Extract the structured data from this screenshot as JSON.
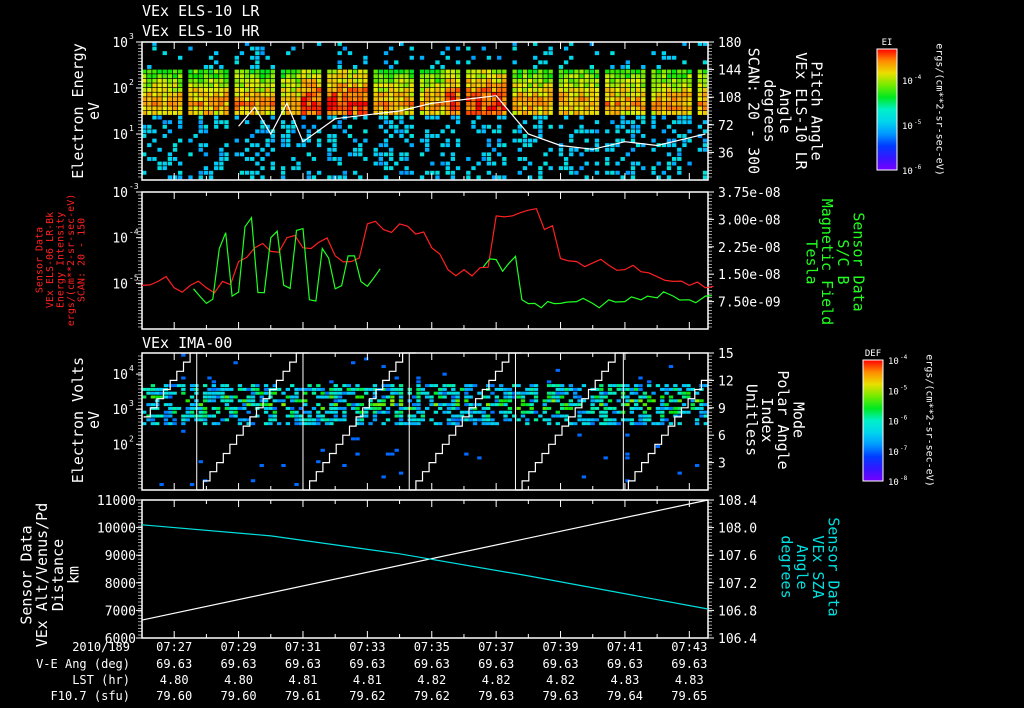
{
  "colors": {
    "white": "#ffffff",
    "red": "#ff2020",
    "green": "#20ff20",
    "cyan": "#00e0e0"
  },
  "time_axis": {
    "start_label": "2010/189",
    "t0_minutes_after_0726": 0,
    "t_end_minutes_after_0726": 17.58,
    "ticks": [
      "07:27",
      "07:29",
      "07:31",
      "07:33",
      "07:35",
      "07:37",
      "07:39",
      "07:41",
      "07:43"
    ],
    "tick_minutes": [
      1,
      3,
      5,
      7,
      9,
      11,
      13,
      15,
      17
    ]
  },
  "ephemeris": [
    {
      "label": "V-E Ang (deg)",
      "values": [
        "69.63",
        "69.63",
        "69.63",
        "69.63",
        "69.63",
        "69.63",
        "69.63",
        "69.63",
        "69.63"
      ]
    },
    {
      "label": "LST (hr)",
      "values": [
        "4.80",
        "4.80",
        "4.81",
        "4.81",
        "4.82",
        "4.82",
        "4.82",
        "4.83",
        "4.83"
      ]
    },
    {
      "label": "F10.7 (sfu)",
      "values": [
        "79.60",
        "79.60",
        "79.61",
        "79.62",
        "79.62",
        "79.63",
        "79.63",
        "79.64",
        "79.65"
      ]
    }
  ],
  "chart_data": [
    {
      "type": "heatmap",
      "title": [
        "VEx ELS-10 LR",
        "VEx ELS-10 HR"
      ],
      "ylabel": [
        "Electron Energy",
        "eV"
      ],
      "yscale": "log",
      "ylim": [
        1,
        1000
      ],
      "yticks": [
        "10",
        "10",
        "10"
      ],
      "yticks_exp": [
        "3",
        "2",
        "1"
      ],
      "y2label": [
        "Pitch Angle",
        "VEx ELS-10 LR",
        "Angle",
        "degrees",
        "SCAN: 20 - 300"
      ],
      "y2lim": [
        0,
        180
      ],
      "y2ticks": [
        "180",
        "144",
        "108",
        "72",
        "36"
      ],
      "colorbar": {
        "title": "EI",
        "ticks": [
          "10",
          "10",
          "10"
        ],
        "ticks_exp": [
          "-4",
          "-5",
          "-6"
        ],
        "units": "ergs/(cm**2-sr-sec-eV)"
      },
      "band_eV": [
        20,
        200
      ],
      "peak_eV": 40,
      "pitch_angle_overlay": {
        "t": [
          0,
          2,
          3,
          3.5,
          4,
          4.5,
          5,
          6,
          7,
          8,
          9,
          10,
          11,
          12,
          13,
          14,
          15,
          16,
          17,
          17.5
        ],
        "deg": [
          null,
          null,
          70,
          95,
          60,
          100,
          50,
          80,
          85,
          90,
          100,
          105,
          110,
          60,
          45,
          40,
          50,
          45,
          55,
          60
        ]
      }
    },
    {
      "type": "line",
      "ylabel": [
        "Sensor Data",
        "VEx ELS-06 LR-Bk",
        "Energy Intensity",
        "ergs/(cm**2-sr-sec-eV)",
        "SCAN: 20 - 150"
      ],
      "yscale": "log",
      "ylim": [
        1e-06,
        0.001
      ],
      "yticks": [
        "10",
        "10",
        "10"
      ],
      "yticks_exp": [
        "-3",
        "-4",
        "-5"
      ],
      "y2label": [
        "Sensor Data",
        "S/C B",
        "Magnetic Field",
        "Tesla"
      ],
      "y2lim": [
        0,
        3.75e-08
      ],
      "y2ticks": [
        "3.75e-08",
        "3.00e-08",
        "2.25e-08",
        "1.50e-08",
        "7.50e-09"
      ],
      "series": [
        {
          "name": "ELS-06 energy intensity",
          "color": "red",
          "axis": "left",
          "t": [
            0,
            0.5,
            1,
            1.5,
            2,
            2.5,
            3,
            3.5,
            4,
            4.5,
            5,
            5.5,
            6,
            6.5,
            7,
            7.5,
            8,
            8.5,
            9,
            9.5,
            10,
            10.5,
            11,
            11.5,
            12,
            12.5,
            13,
            13.5,
            14,
            14.5,
            15,
            15.5,
            16,
            16.5,
            17,
            17.5
          ],
          "values": [
            9e-06,
            1.1e-05,
            8e-06,
            9e-06,
            8e-06,
            1.1e-05,
            3e-05,
            6e-05,
            5e-05,
            0.0001,
            6e-05,
            8e-05,
            4e-05,
            3e-05,
            0.0002,
            0.00015,
            0.0002,
            0.00012,
            6e-05,
            2e-05,
            2e-05,
            2.2e-05,
            0.0003,
            0.0003,
            0.0004,
            0.00015,
            3.5e-05,
            3e-05,
            2.8e-05,
            2.5e-05,
            2e-05,
            1.8e-05,
            1.4e-05,
            1.1e-05,
            9e-06,
            8e-06
          ]
        },
        {
          "name": "S/C B magnetic field",
          "color": "green",
          "axis": "right",
          "t": [
            1.6,
            2,
            2.4,
            2.8,
            3.2,
            3.6,
            4,
            4.4,
            4.8,
            5.2,
            5.6,
            6,
            6.4,
            6.8,
            7.2,
            10.6,
            11,
            11.4,
            11.8,
            12.2,
            12.6,
            13,
            13.5,
            14,
            14.5,
            15,
            15.5,
            16,
            16.5,
            17,
            17.5
          ],
          "values": [
            1.1e-08,
            7e-09,
            2.2e-08,
            9e-09,
            2.8e-08,
            1e-08,
            2.5e-08,
            1.2e-08,
            2.7e-08,
            8e-09,
            2.2e-08,
            1.1e-08,
            2e-08,
            1.3e-08,
            1.4e-08,
            1.7e-08,
            1.9e-08,
            1.8e-08,
            8e-09,
            7e-09,
            7.5e-09,
            7e-09,
            7.5e-09,
            7e-09,
            8e-09,
            7.5e-09,
            8e-09,
            8.5e-09,
            9e-09,
            8e-09,
            9e-09
          ]
        }
      ]
    },
    {
      "type": "heatmap",
      "title": "VEx IMA-00",
      "ylabel": [
        "Electron Volts",
        "eV"
      ],
      "yscale": "log",
      "ylim": [
        5,
        40000
      ],
      "yticks": [
        "10",
        "10",
        "10"
      ],
      "yticks_exp": [
        "4",
        "3",
        "2"
      ],
      "y2label": [
        "Mode",
        "Polar Angle",
        "Index",
        "Unitless"
      ],
      "y2lim": [
        0,
        15
      ],
      "y2ticks": [
        "15",
        "12",
        "9",
        "6",
        "3"
      ],
      "colorbar": {
        "title": "DEF",
        "ticks": [
          "10",
          "10",
          "10",
          "10",
          "10"
        ],
        "ticks_exp": [
          "-4",
          "-5",
          "-6",
          "-7",
          "-8"
        ],
        "units": "ergs/(cm**2-sr-sec-eV)"
      },
      "scan_resets_minutes": [
        1.7,
        5.0,
        8.3,
        11.6,
        14.95
      ],
      "band_eV": [
        300,
        5000
      ]
    },
    {
      "type": "line",
      "ylabel": [
        "Sensor Data",
        "VEx Alt/Venus/Pd",
        "Distance",
        "km"
      ],
      "ylim": [
        6000,
        11000
      ],
      "yticks": [
        "11000",
        "10000",
        "9000",
        "8000",
        "7000",
        "6000"
      ],
      "y2label": [
        "Sensor Data",
        "VEx SZA",
        "Angle",
        "degrees"
      ],
      "y2lim": [
        106.4,
        108.4
      ],
      "y2ticks": [
        "108.4",
        "108.0",
        "107.6",
        "107.2",
        "106.8",
        "106.4"
      ],
      "series": [
        {
          "name": "Altitude",
          "color": "white",
          "axis": "left",
          "t": [
            0,
            17.58
          ],
          "values": [
            6650,
            11000
          ]
        },
        {
          "name": "SZA",
          "color": "cyan",
          "axis": "right",
          "t": [
            0,
            4,
            8,
            12,
            17.58
          ],
          "values": [
            108.04,
            107.88,
            107.62,
            107.3,
            106.82
          ]
        }
      ]
    }
  ]
}
